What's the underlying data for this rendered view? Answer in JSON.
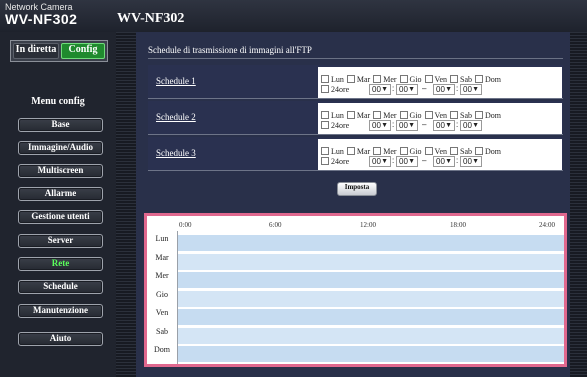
{
  "header": {
    "brand_sub": "Network Camera",
    "brand_model": "WV-NF302",
    "page_model": "WV-NF302"
  },
  "sidebar": {
    "live_label": "In diretta",
    "config_label": "Config",
    "menu_title": "Menu config",
    "items": [
      {
        "label": "Base"
      },
      {
        "label": "Immagine/Audio"
      },
      {
        "label": "Multiscreen"
      },
      {
        "label": "Allarme"
      },
      {
        "label": "Gestione utenti"
      },
      {
        "label": "Server"
      },
      {
        "label": "Rete",
        "active": true
      },
      {
        "label": "Schedule"
      },
      {
        "label": "Manutenzione"
      },
      {
        "label": "Aiuto"
      }
    ]
  },
  "main": {
    "section_title": "Schedule di trasmissione di immagini all'FTP",
    "days": [
      "Lun",
      "Mar",
      "Mer",
      "Gio",
      "Ven",
      "Sab",
      "Dom"
    ],
    "all_day_label": "24ore",
    "schedules": [
      {
        "label": "Schedule 1",
        "start_h": "00",
        "start_m": "00",
        "end_h": "00",
        "end_m": "00"
      },
      {
        "label": "Schedule 2",
        "start_h": "00",
        "start_m": "00",
        "end_h": "00",
        "end_m": "00"
      },
      {
        "label": "Schedule 3",
        "start_h": "00",
        "start_m": "00",
        "end_h": "00",
        "end_m": "00"
      }
    ],
    "colon": ":",
    "dash": "–",
    "submit_label": "Imposta"
  },
  "timeline": {
    "hours": [
      "0:00",
      "6:00",
      "12:00",
      "18:00",
      "24:00"
    ],
    "days": [
      "Lun",
      "Mar",
      "Mer",
      "Gio",
      "Ven",
      "Sab",
      "Dom"
    ]
  },
  "colors": {
    "accent_active": "#5bff5b",
    "config_bg": "#1f8a2e",
    "timeline_border": "#e0688f",
    "timeline_bar": "#c6dcf1"
  }
}
